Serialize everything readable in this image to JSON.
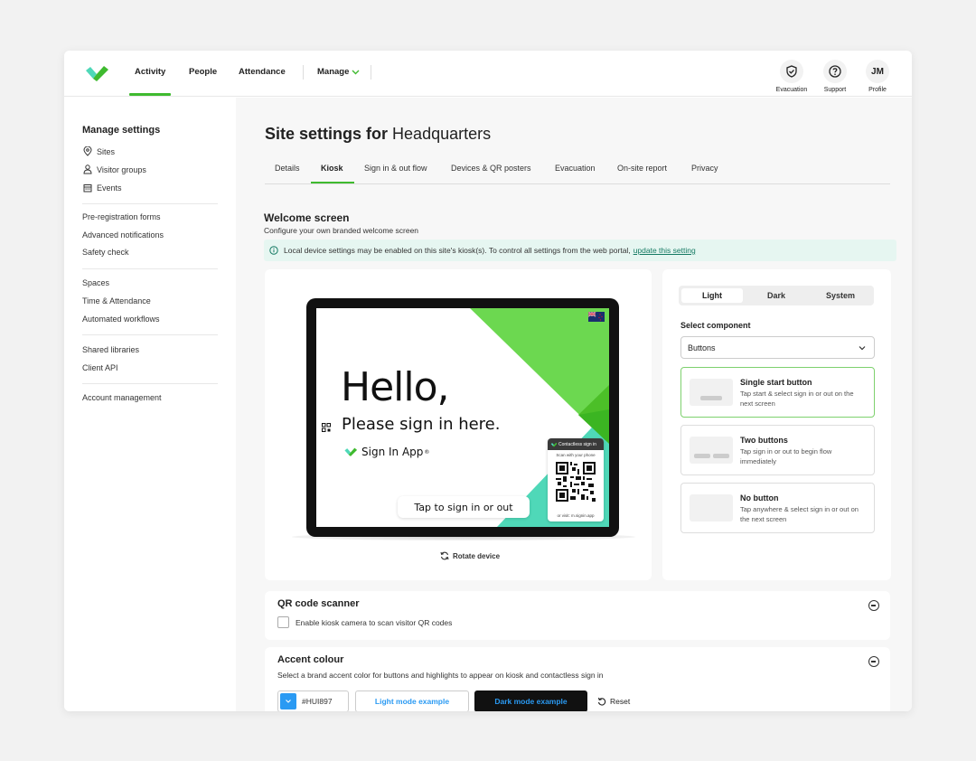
{
  "nav": {
    "items": [
      "Activity",
      "People",
      "Attendance"
    ],
    "manage_label": "Manage",
    "active_index": 0
  },
  "top_actions": {
    "evacuation": "Evacuation",
    "support": "Support",
    "profile_initials": "JM",
    "profile": "Profile"
  },
  "sidebar": {
    "title": "Manage settings",
    "group1": [
      "Sites",
      "Visitor groups",
      "Events"
    ],
    "group2": [
      "Pre-registration forms",
      "Advanced notifications",
      "Safety check"
    ],
    "group3": [
      "Spaces",
      "Time & Attendance",
      "Automated workflows"
    ],
    "group4": [
      "Shared libraries",
      "Client API"
    ],
    "group5": [
      "Account management"
    ]
  },
  "page": {
    "title_prefix": "Site settings for",
    "site_name": "Headquarters",
    "tabs": [
      "Details",
      "Kiosk",
      "Sign in & out flow",
      "Devices & QR posters",
      "Evacuation",
      "On-site report",
      "Privacy"
    ],
    "active_tab": "Kiosk"
  },
  "welcome": {
    "title": "Welcome screen",
    "subtitle": "Configure your own branded welcome screen",
    "info_text": "Local device settings may be enabled on this site's kiosk(s). To control all settings from the web portal,",
    "info_link": "update this setting"
  },
  "kiosk_preview": {
    "hello": "Hello,",
    "please": "Please sign in here.",
    "brand": "Sign In App",
    "tap_button": "Tap to sign in or out",
    "qr_header": "Contactless sign in",
    "qr_sub": "Scan with your phone",
    "qr_foot": "or visit: m.signin.app",
    "rotate": "Rotate device"
  },
  "controls": {
    "modes": [
      "Light",
      "Dark",
      "System"
    ],
    "active_mode": "Light",
    "select_label": "Select component",
    "select_value": "Buttons",
    "options": [
      {
        "title": "Single start button",
        "desc": "Tap start & select sign in or out on the next screen",
        "selected": true
      },
      {
        "title": "Two buttons",
        "desc": "Tap sign in or out to begin flow immediately",
        "selected": false
      },
      {
        "title": "No button",
        "desc": "Tap anywhere & select sign in or out on the next screen",
        "selected": false
      }
    ]
  },
  "qr_scanner": {
    "title": "QR code scanner",
    "checkbox_label": "Enable kiosk camera to scan visitor QR codes"
  },
  "accent": {
    "title": "Accent colour",
    "subtitle": "Select a brand accent color for buttons and highlights to appear on kiosk and contactless sign in",
    "hex_value": "#HUI897",
    "light_example": "Light mode example",
    "dark_example": "Dark mode example",
    "reset": "Reset",
    "swatch_color": "#2a9af3"
  },
  "colors": {
    "brand_green": "#3fba2f",
    "accent_blue": "#2a9af3",
    "teal": "#4fd8b8"
  }
}
